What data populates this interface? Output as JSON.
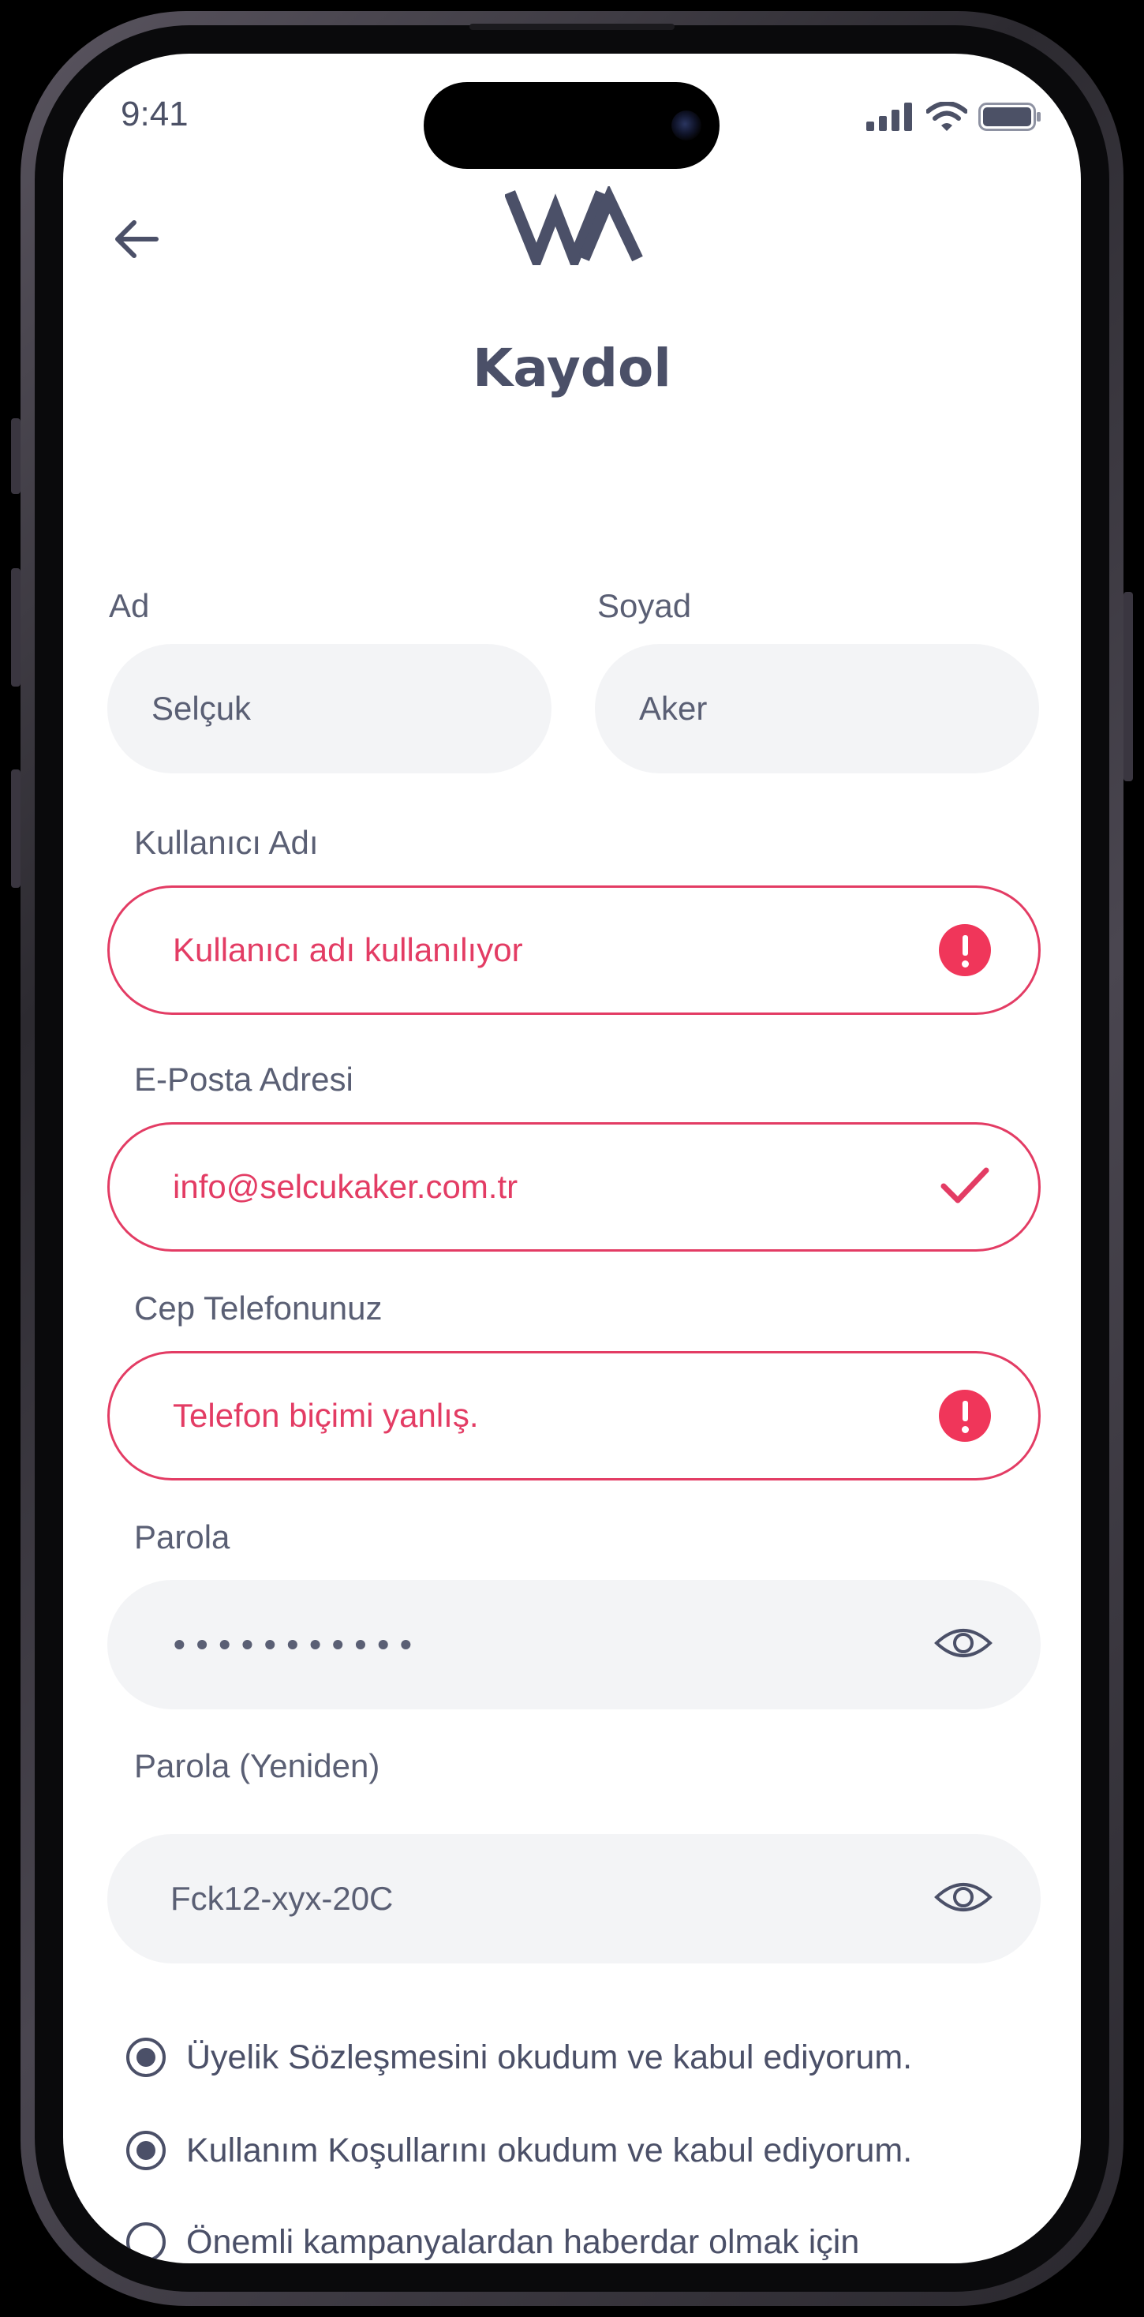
{
  "status_bar": {
    "time": "9:41"
  },
  "header": {
    "title": "Kaydol"
  },
  "form": {
    "first_name": {
      "label": "Ad",
      "value": "Selçuk"
    },
    "last_name": {
      "label": "Soyad",
      "value": "Aker"
    },
    "username": {
      "label": "Kullanıcı Adı",
      "value": "Kullanıcı adı kullanılıyor",
      "state": "error"
    },
    "email": {
      "label": "E-Posta Adresi",
      "value": "info@selcukaker.com.tr",
      "state": "valid"
    },
    "phone": {
      "label": "Cep Telefonunuz",
      "value": "Telefon biçimi yanlış.",
      "state": "error"
    },
    "password": {
      "label": "Parola",
      "value": "•••••••••••",
      "icon": "eye-icon"
    },
    "password_repeat": {
      "label": "Parola (Yeniden)",
      "value": "Fck12-xyx-20C",
      "icon": "eye-icon"
    }
  },
  "agreements": [
    {
      "text": "Üyelik Sözleşmesini okudum ve kabul ediyorum.",
      "checked": true
    },
    {
      "text": "Kullanım Koşullarını okudum ve kabul ediyorum.",
      "checked": true
    },
    {
      "text": "Önemli kampanyalardan haberdar olmak için",
      "checked": false
    }
  ],
  "colors": {
    "text": "#4b5068",
    "error": "#e33c64",
    "field_bg": "#f3f4f6"
  }
}
